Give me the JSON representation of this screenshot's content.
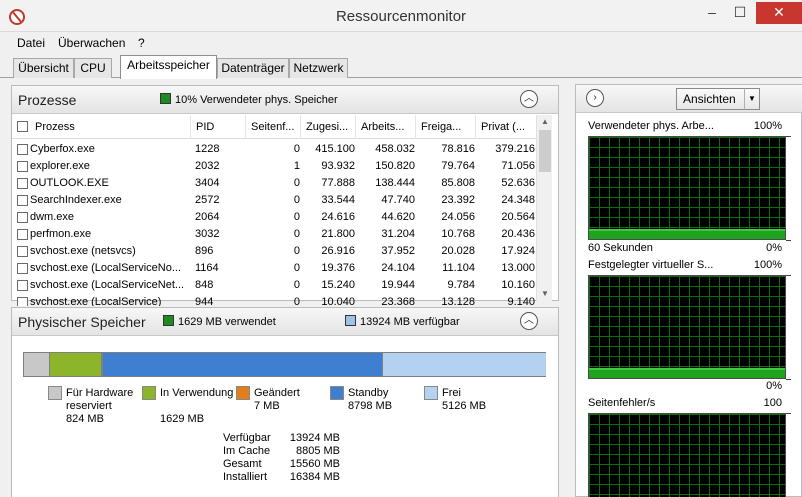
{
  "window": {
    "title": "Ressourcenmonitor",
    "minimize": "–",
    "maximize": "☐",
    "close": "✕"
  },
  "menu": [
    "Datei",
    "Überwachen",
    "?"
  ],
  "tabs": [
    {
      "label": "Übersicht",
      "active": false
    },
    {
      "label": "CPU",
      "active": false
    },
    {
      "label": "Arbeitsspeicher",
      "active": true
    },
    {
      "label": "Datenträger",
      "active": false
    },
    {
      "label": "Netzwerk",
      "active": false
    }
  ],
  "processes": {
    "title": "Prozesse",
    "summary": "10% Verwendeter phys. Speicher",
    "summary_color": "#1f8a1f",
    "columns": [
      "Prozess",
      "PID",
      "Seitenf...",
      "Zugesi...",
      "Arbeits...",
      "Freiga...",
      "Privat (..."
    ],
    "rows": [
      [
        "Cyberfox.exe",
        "1228",
        "0",
        "415.100",
        "458.032",
        "78.816",
        "379.216"
      ],
      [
        "explorer.exe",
        "2032",
        "1",
        "93.932",
        "150.820",
        "79.764",
        "71.056"
      ],
      [
        "OUTLOOK.EXE",
        "3404",
        "0",
        "77.888",
        "138.444",
        "85.808",
        "52.636"
      ],
      [
        "SearchIndexer.exe",
        "2572",
        "0",
        "33.544",
        "47.740",
        "23.392",
        "24.348"
      ],
      [
        "dwm.exe",
        "2064",
        "0",
        "24.616",
        "44.620",
        "24.056",
        "20.564"
      ],
      [
        "perfmon.exe",
        "3032",
        "0",
        "21.800",
        "31.204",
        "10.768",
        "20.436"
      ],
      [
        "svchost.exe (netsvcs)",
        "896",
        "0",
        "26.916",
        "37.952",
        "20.028",
        "17.924"
      ],
      [
        "svchost.exe (LocalServiceNo...",
        "1164",
        "0",
        "19.376",
        "24.104",
        "11.104",
        "13.000"
      ],
      [
        "svchost.exe (LocalServiceNet...",
        "848",
        "0",
        "15.240",
        "19.944",
        "9.784",
        "10.160"
      ],
      [
        "svchost.exe (LocalService)",
        "944",
        "0",
        "10.040",
        "23.368",
        "13.128",
        "9.140"
      ]
    ]
  },
  "physical": {
    "title": "Physischer Speicher",
    "used_label": "1629 MB verwendet",
    "used_color": "#1f8a1f",
    "avail_label": "13924 MB verfügbar",
    "avail_color": "#9dc3e6",
    "bar": [
      {
        "name": "hardware",
        "mb": 824,
        "color": "#c8c8c8"
      },
      {
        "name": "inuse",
        "mb": 1629,
        "color": "#8db52b"
      },
      {
        "name": "modified",
        "mb": 7,
        "color": "#e07f1c"
      },
      {
        "name": "standby",
        "mb": 8798,
        "color": "#3f7fcf"
      },
      {
        "name": "free",
        "mb": 5126,
        "color": "#b5d1f1"
      }
    ],
    "legend": [
      {
        "label": "Für Hardware reserviert",
        "value": "824 MB",
        "color": "#c8c8c8"
      },
      {
        "label": "In Verwendung",
        "value": "1629 MB",
        "color": "#8db52b"
      },
      {
        "label": "Geändert",
        "value": "7 MB",
        "color": "#e07f1c"
      },
      {
        "label": "Standby",
        "value": "8798 MB",
        "color": "#3f7fcf"
      },
      {
        "label": "Frei",
        "value": "5126 MB",
        "color": "#b5d1f1"
      }
    ],
    "stats": [
      {
        "label": "Verfügbar",
        "value": "13924 MB"
      },
      {
        "label": "Im Cache",
        "value": "8805 MB"
      },
      {
        "label": "Gesamt",
        "value": "15560 MB"
      },
      {
        "label": "Installiert",
        "value": "16384 MB"
      }
    ]
  },
  "right": {
    "expand": "›",
    "views_label": "Ansichten",
    "views_drop": "▼",
    "graphs": [
      {
        "title": "Verwendeter phys. Arbe...",
        "max": "100%",
        "footer_left": "60 Sekunden",
        "footer_right": "0%",
        "level": 0.1
      },
      {
        "title": "Festgelegter virtueller S...",
        "max": "100%",
        "footer_left": "",
        "footer_right": "0%",
        "level": 0.1
      },
      {
        "title": "Seitenfehler/s",
        "max": "100",
        "footer_left": "",
        "footer_right": "",
        "level": 0
      }
    ]
  }
}
